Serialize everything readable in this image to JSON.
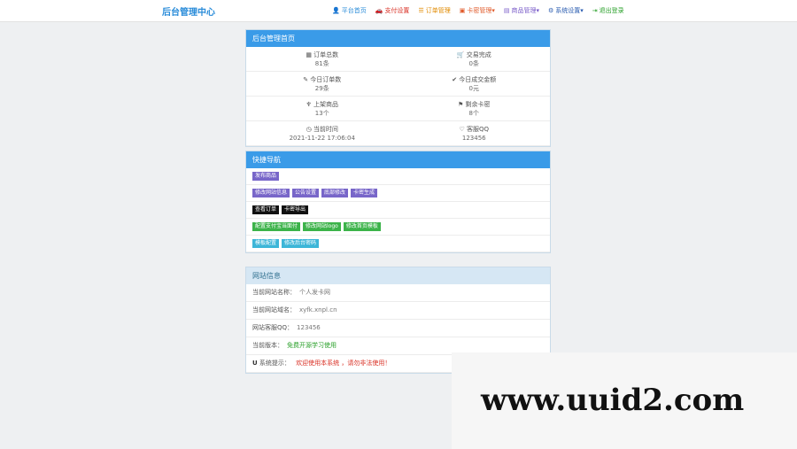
{
  "brand": "后台管理中心",
  "nav": [
    {
      "icon": "user-icon",
      "glyph": "👤",
      "label": "平台首页",
      "color": "#2a8cd9"
    },
    {
      "icon": "car-icon",
      "glyph": "🚗",
      "label": "支付设置",
      "color": "#d93025"
    },
    {
      "icon": "list-icon",
      "glyph": "☰",
      "label": "订单管理",
      "color": "#e08a00"
    },
    {
      "icon": "card-icon",
      "glyph": "▣",
      "label": "卡密管理▾",
      "color": "#e05a2a"
    },
    {
      "icon": "book-icon",
      "glyph": "▤",
      "label": "商品管理▾",
      "color": "#7a5cc9"
    },
    {
      "icon": "gear-icon",
      "glyph": "⚙",
      "label": "系统设置▾",
      "color": "#2a5cb0"
    },
    {
      "icon": "exit-icon",
      "glyph": "⇥",
      "label": "退出登录",
      "color": "#2aa02a"
    }
  ],
  "home_panel": {
    "title": "后台管理首页",
    "stats": [
      {
        "icon": "bar-icon",
        "glyph": "▦",
        "label": "订单总数",
        "value": "81条"
      },
      {
        "icon": "cart-icon",
        "glyph": "🛒",
        "label": "交易完成",
        "value": "0条"
      },
      {
        "icon": "leaf-icon",
        "glyph": "✎",
        "label": "今日订单数",
        "value": "29条"
      },
      {
        "icon": "check-icon",
        "glyph": "✔",
        "label": "今日成交金额",
        "value": "0元"
      },
      {
        "icon": "mic-icon",
        "glyph": "♆",
        "label": "上架商品",
        "value": "13个"
      },
      {
        "icon": "tag-icon",
        "glyph": "⚑",
        "label": "剩余卡密",
        "value": "8个"
      },
      {
        "icon": "clock-icon",
        "glyph": "◷",
        "label": "当前时间",
        "value": "2021-11-22 17:06:04"
      },
      {
        "icon": "heart-icon",
        "glyph": "♡",
        "label": "客服QQ",
        "value": "123456"
      }
    ]
  },
  "quick_panel": {
    "title": "快捷导航",
    "rows": [
      [
        {
          "label": "发布商品",
          "style": "purple"
        }
      ],
      [
        {
          "label": "修改网站信息",
          "style": "purple"
        },
        {
          "label": "公告设置",
          "style": "purple"
        },
        {
          "label": "底部修改",
          "style": "purple"
        },
        {
          "label": "卡密生成",
          "style": "purple"
        }
      ],
      [
        {
          "label": "查看订单",
          "style": "black"
        },
        {
          "label": "卡密导出",
          "style": "black"
        }
      ],
      [
        {
          "label": "配置支付宝当面付",
          "style": "green"
        },
        {
          "label": "修改网站logo",
          "style": "green"
        },
        {
          "label": "修改首页模板",
          "style": "green"
        }
      ],
      [
        {
          "label": "模板配置",
          "style": "teal"
        },
        {
          "label": "修改后台密码",
          "style": "teal"
        }
      ]
    ]
  },
  "info_panel": {
    "title": "网站信息",
    "rows": [
      {
        "label": "当前网站名称：",
        "value": "个人发卡网",
        "tone": "v"
      },
      {
        "label": "当前网站域名：",
        "value": "xyfk.xnpl.cn",
        "tone": "v"
      },
      {
        "label": "网站客服QQ：",
        "value": "123456",
        "tone": "v"
      },
      {
        "label": "当前版本：",
        "value": "免费开源学习使用",
        "tone": "vg"
      }
    ],
    "tip": {
      "icon": "info-icon",
      "glyph": "U",
      "label": "系统提示：",
      "value": "欢迎使用本系统 ，请勿非法使用！"
    }
  },
  "watermark": "www.uuid2.com"
}
